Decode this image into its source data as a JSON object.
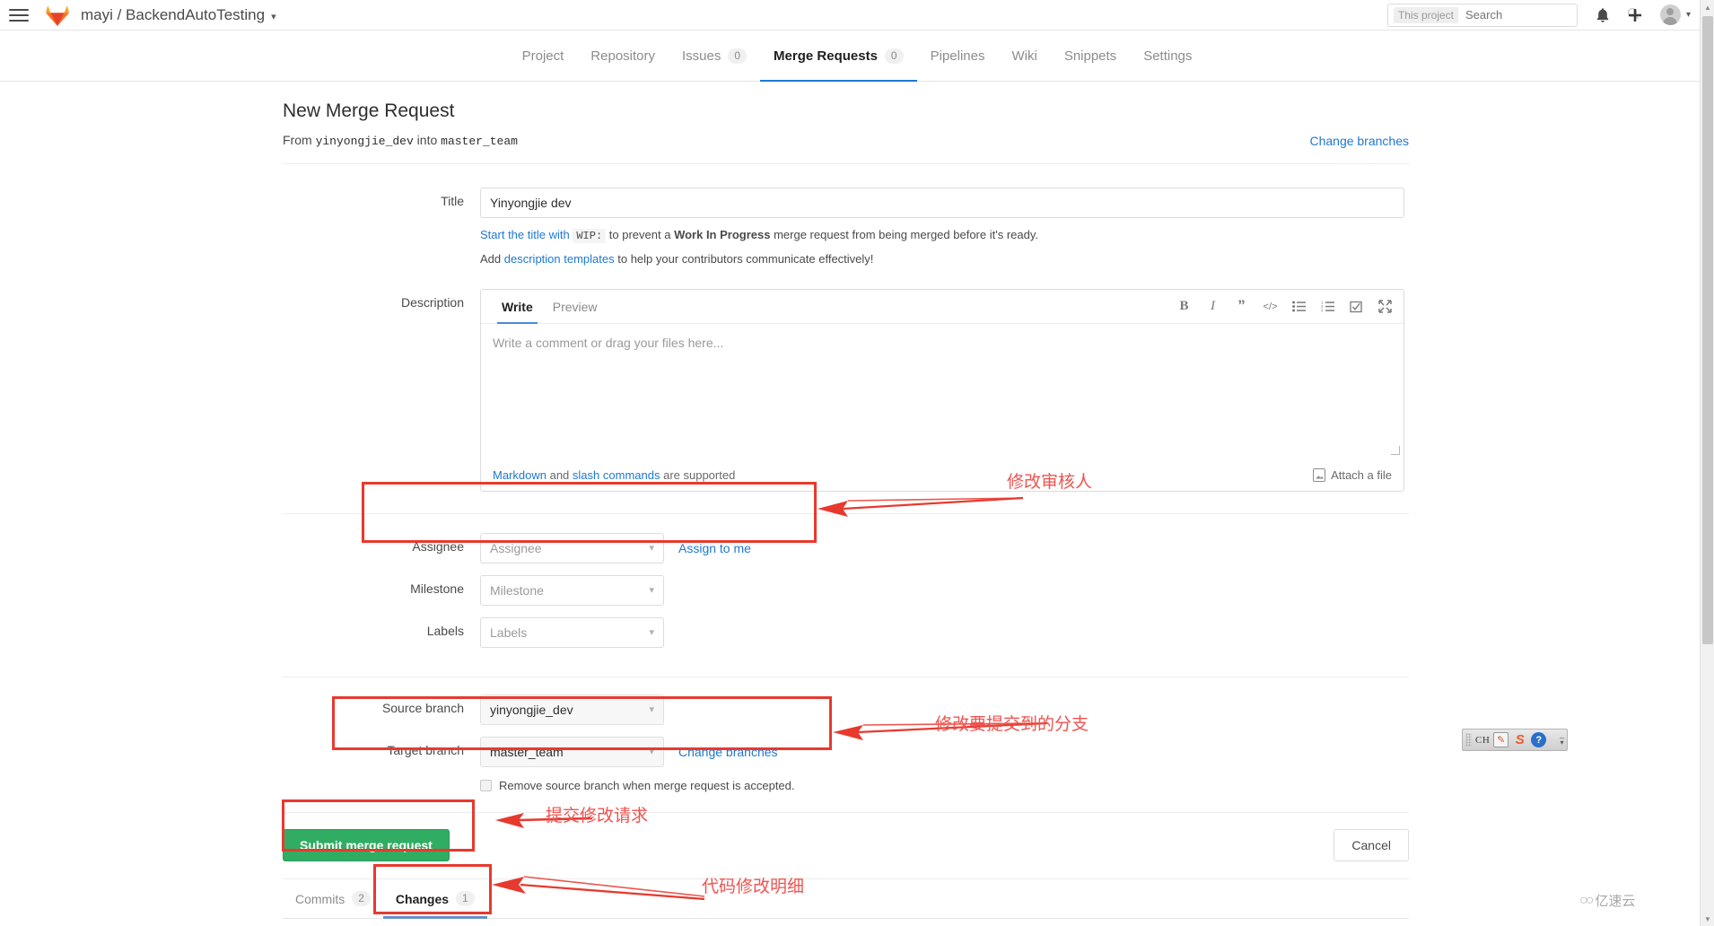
{
  "navbar": {
    "hamburger": "menu-icon",
    "brand_title": "mayi / BackendAutoTesting",
    "brand_caret": "▾",
    "search": {
      "scope": "This project",
      "placeholder": "Search",
      "value": ""
    },
    "icons": {
      "bell": "bell-icon",
      "plus": "plus-icon",
      "avatar_caret": "▾"
    }
  },
  "subnav": {
    "items": [
      {
        "label": "Project",
        "count": null,
        "active": false
      },
      {
        "label": "Repository",
        "count": null,
        "active": false
      },
      {
        "label": "Issues",
        "count": "0",
        "active": false
      },
      {
        "label": "Merge Requests",
        "count": "0",
        "active": true
      },
      {
        "label": "Pipelines",
        "count": null,
        "active": false
      },
      {
        "label": "Wiki",
        "count": null,
        "active": false
      },
      {
        "label": "Snippets",
        "count": null,
        "active": false
      },
      {
        "label": "Settings",
        "count": null,
        "active": false
      }
    ]
  },
  "main": {
    "page_title": "New Merge Request",
    "branch_line": {
      "from_word": "From",
      "source": "yinyongjie_dev",
      "into_word": "into",
      "target": "master_team",
      "change_branches": "Change branches"
    },
    "title_field": {
      "label": "Title",
      "value": "Yinyongjie dev",
      "placeholder": "Title"
    },
    "hints": {
      "wip_prefix": "Start the title with",
      "wip_code": "WIP:",
      "wip_middle": "to prevent a",
      "wip_bold": "Work In Progress",
      "wip_suffix": "merge request from being merged before it's ready.",
      "templates_prefix": "Add",
      "templates_link": "description templates",
      "templates_suffix": "to help your contributors communicate effectively!"
    },
    "description": {
      "label": "Description",
      "tabs": [
        {
          "label": "Write",
          "active": true
        },
        {
          "label": "Preview",
          "active": false
        }
      ],
      "tools": [
        {
          "name": "bold-icon",
          "glyph": "B"
        },
        {
          "name": "italic-icon",
          "glyph": "I"
        },
        {
          "name": "quote-icon",
          "glyph": "”"
        },
        {
          "name": "code-icon",
          "glyph": "</>"
        },
        {
          "name": "bullet-list-icon",
          "glyph": "☰"
        },
        {
          "name": "numbered-list-icon",
          "glyph": "☷"
        },
        {
          "name": "task-list-icon",
          "glyph": "☑"
        },
        {
          "name": "fullscreen-icon",
          "glyph": "⤢"
        }
      ],
      "placeholder": "Write a comment or drag your files here...",
      "value": "",
      "footer_link_markdown": "Markdown",
      "footer_and": "and",
      "footer_link_slash": "slash commands",
      "footer_suffix": "are supported",
      "attach_label": "Attach a file"
    },
    "assignee": {
      "label": "Assignee",
      "select_value": "Assignee",
      "assign_to_me": "Assign to me"
    },
    "milestone": {
      "label": "Milestone",
      "select_value": "Milestone"
    },
    "labels": {
      "label": "Labels",
      "select_value": "Labels"
    },
    "source_branch": {
      "label": "Source branch",
      "value": "yinyongjie_dev"
    },
    "target_branch": {
      "label": "Target branch",
      "value": "master_team",
      "change_branches": "Change branches"
    },
    "remove_source_checkbox": {
      "label": "Remove source branch when merge request is accepted.",
      "checked": false
    },
    "actions": {
      "submit_label": "Submit merge request",
      "cancel_label": "Cancel"
    },
    "mr_tabs": [
      {
        "label": "Commits",
        "count": "2",
        "active": false
      },
      {
        "label": "Changes",
        "count": "1",
        "active": true
      }
    ]
  },
  "annotations": [
    {
      "name": "annotation-assignee",
      "text": "修改审核人"
    },
    {
      "name": "annotation-target-branch",
      "text": "修改要提交到的分支"
    },
    {
      "name": "annotation-submit",
      "text": "提交修改请求"
    },
    {
      "name": "annotation-changes",
      "text": "代码修改明细"
    }
  ],
  "ime_bar": {
    "language": "CH",
    "icons": [
      "handwriting-pad-icon",
      "sogou-icon",
      "help-icon"
    ],
    "caret": "▾"
  },
  "watermark": {
    "logo": "○○",
    "text": "亿速云"
  },
  "colors": {
    "accent_blue": "#1f78d1",
    "submit_green": "#31ad63",
    "annotation_red": "#e8392e",
    "gitlab_orange": "#fc6d26"
  }
}
